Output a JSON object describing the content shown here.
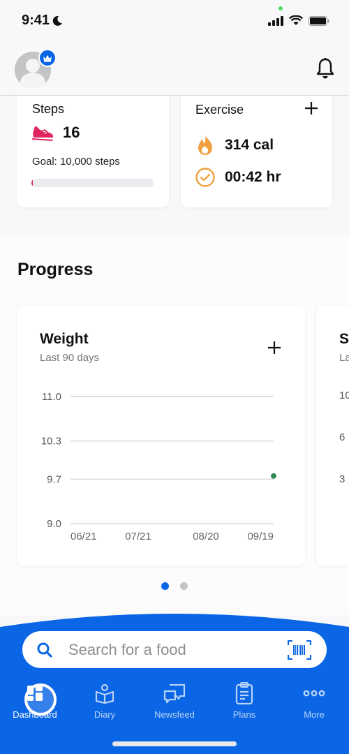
{
  "status_bar": {
    "time": "9:41",
    "icons": [
      "moon-icon",
      "signal-icon",
      "wifi-icon",
      "battery-icon"
    ]
  },
  "header": {
    "avatar_icon": "user-avatar-icon",
    "badge_icon": "crown-icon",
    "notification_icon": "bell-icon"
  },
  "steps_card": {
    "title": "Steps",
    "icon": "sneaker-icon",
    "value": "16",
    "goal_label": "Goal: 10,000 steps",
    "progress_fraction": 0.0016,
    "accent": "#e0245e"
  },
  "exercise_card": {
    "title": "Exercise",
    "add_icon": "plus-icon",
    "calories": "314 cal",
    "calories_icon": "flame-icon",
    "duration": "00:42 hr",
    "duration_icon": "check-circle-icon",
    "accent": "#f0a040"
  },
  "progress": {
    "title": "Progress",
    "weight_card": {
      "title": "Weight",
      "subtitle": "Last 90 days",
      "add_icon": "plus-icon"
    },
    "next_card": {
      "title_partial": "S",
      "subtitle_partial": "La",
      "ticks_partial": [
        "10",
        "6",
        "3"
      ]
    },
    "page_dots": {
      "count": 2,
      "active": 0
    }
  },
  "chart_data": {
    "type": "scatter",
    "title": "Weight",
    "subtitle": "Last 90 days",
    "xlabel": "",
    "ylabel": "",
    "y_ticks": [
      "11.0",
      "10.3",
      "9.7",
      "9.0"
    ],
    "y_tick_values": [
      11.0,
      10.3,
      9.7,
      9.0
    ],
    "ylim": [
      9.0,
      11.0
    ],
    "x_ticks": [
      "06/21",
      "07/21",
      "08/20",
      "09/19"
    ],
    "x_tick_days": [
      0,
      30,
      60,
      90
    ],
    "xlim_days": [
      0,
      90
    ],
    "grid": true,
    "points": [
      {
        "x_day": 90,
        "x_label": "09/19",
        "y": 9.75
      }
    ],
    "point_color": "#2e8b57"
  },
  "search": {
    "placeholder": "Search for a food",
    "search_icon": "search-icon",
    "barcode_icon": "barcode-scan-icon"
  },
  "tabbar": {
    "items": [
      {
        "label": "Dashboard",
        "icon": "dashboard-icon",
        "active": true
      },
      {
        "label": "Diary",
        "icon": "diary-book-icon",
        "active": false
      },
      {
        "label": "Newsfeed",
        "icon": "chat-bubbles-icon",
        "active": false
      },
      {
        "label": "Plans",
        "icon": "clipboard-icon",
        "active": false
      },
      {
        "label": "More",
        "icon": "more-dots-icon",
        "active": false
      }
    ]
  },
  "colors": {
    "brand_blue": "#0a66e4",
    "steps_pink": "#e0245e",
    "exercise_orange": "#f0a040",
    "weight_point_green": "#2e8b57"
  }
}
